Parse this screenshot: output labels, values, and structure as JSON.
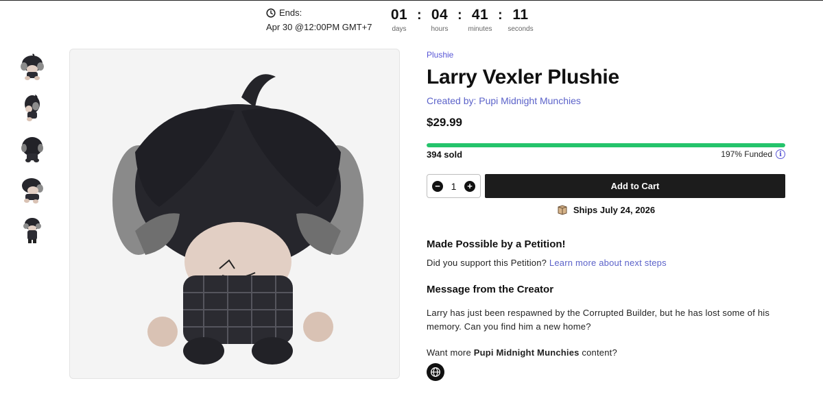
{
  "countdown": {
    "ends_label": "Ends:",
    "ends_date": "Apr 30 @12:00PM GMT+7",
    "days": "01",
    "days_label": "days",
    "hours": "04",
    "hours_label": "hours",
    "minutes": "41",
    "minutes_label": "minutes",
    "seconds": "11",
    "seconds_label": "seconds",
    "separator": ":"
  },
  "gallery": {
    "thumbnails": [
      "plushie-front",
      "plushie-side",
      "plushie-back",
      "plushie-angle",
      "plushie-full"
    ]
  },
  "product": {
    "category": "Plushie",
    "title": "Larry Vexler Plushie",
    "creator": "Created by: Pupi Midnight Munchies",
    "price": "$29.99",
    "sold": "394 sold",
    "funded": "197% Funded",
    "funded_progress": 1.0,
    "quantity": "1",
    "add_to_cart": "Add to Cart",
    "ships": "Ships July 24, 2026"
  },
  "petition": {
    "heading": "Made Possible by a Petition!",
    "question": "Did you support this Petition?",
    "link": "Learn more about next steps"
  },
  "message": {
    "heading": "Message from the Creator",
    "text": "Larry has just been respawned by the Corrupted Builder, but he has lost some of his memory. Can you find him a new home?"
  },
  "more": {
    "prefix": "Want more",
    "creator": "Pupi Midnight Munchies",
    "suffix": "content?"
  },
  "colors": {
    "accent": "#5856d6",
    "progress": "#24c46b",
    "button": "#1c1c1c"
  }
}
